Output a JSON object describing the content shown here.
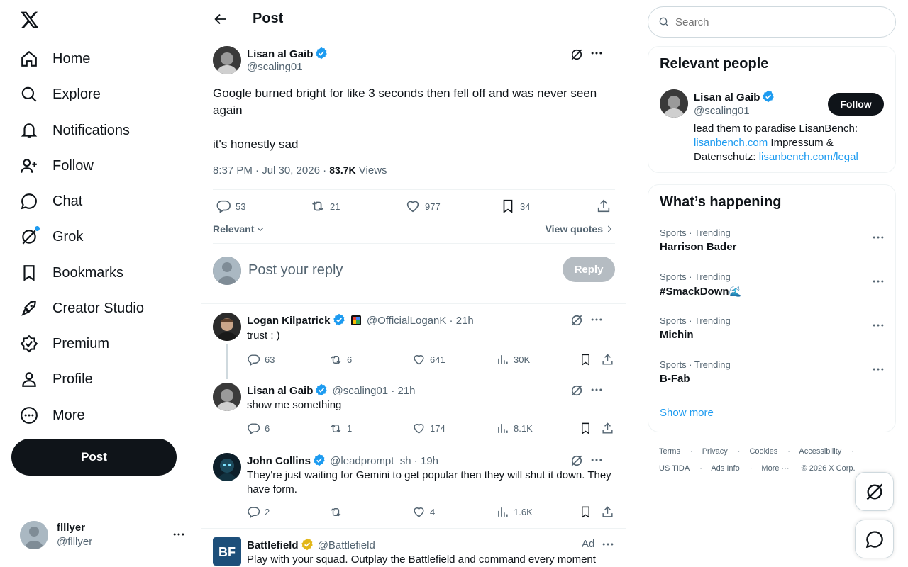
{
  "nav": {
    "items": [
      {
        "label": "Home",
        "icon": "home-icon"
      },
      {
        "label": "Explore",
        "icon": "search-icon"
      },
      {
        "label": "Notifications",
        "icon": "bell-icon"
      },
      {
        "label": "Follow",
        "icon": "person-add-icon"
      },
      {
        "label": "Chat",
        "icon": "chat-icon"
      },
      {
        "label": "Grok",
        "icon": "grok-icon"
      },
      {
        "label": "Bookmarks",
        "icon": "bookmark-icon"
      },
      {
        "label": "Creator Studio",
        "icon": "rocket-icon"
      },
      {
        "label": "Premium",
        "icon": "premium-icon"
      },
      {
        "label": "Profile",
        "icon": "person-icon"
      },
      {
        "label": "More",
        "icon": "more-circle-icon"
      }
    ],
    "post_label": "Post",
    "account": {
      "name": "flllyer",
      "handle": "@flllyer"
    }
  },
  "header": {
    "title": "Post"
  },
  "focal_post": {
    "name": "Lisan al Gaib",
    "handle": "@scaling01",
    "text": "Google burned bright for like 3 seconds then fell off and was never seen again\n\nit's honestly sad",
    "time": "8:37 PM · Jul 30, 2026 · ",
    "views": "83.7K",
    "views_label": " Views",
    "replies": "53",
    "reposts": "21",
    "likes": "977",
    "bookmarks": "34",
    "sort_label": "Relevant",
    "view_quotes": "View quotes"
  },
  "reply_box": {
    "placeholder": "Post your reply",
    "button": "Reply"
  },
  "replies": [
    {
      "name": "Logan Kilpatrick",
      "handle": "@OfficialLoganK",
      "time": "21h",
      "text": "trust : )",
      "replies": "63",
      "reposts": "6",
      "likes": "641",
      "views": "30K"
    },
    {
      "name": "Lisan al Gaib",
      "handle": "@scaling01",
      "time": "21h",
      "text": "show me something",
      "replies": "6",
      "reposts": "1",
      "likes": "174",
      "views": "8.1K"
    },
    {
      "name": "John Collins",
      "handle": "@leadprompt_sh",
      "time": "19h",
      "text": "They're just waiting for Gemini to get popular then they will shut it down. They have form.",
      "replies": "2",
      "reposts": "",
      "likes": "4",
      "views": "1.6K"
    },
    {
      "name": "Battlefield",
      "handle": "@Battlefield",
      "time": "Ad",
      "text": "Play with your squad. Outplay the Battlefield and command every moment"
    }
  ],
  "search": {
    "placeholder": "Search"
  },
  "relevant_people": {
    "title": "Relevant people",
    "name": "Lisan al Gaib",
    "handle": "@scaling01",
    "follow": "Follow",
    "bio_prefix": "lead them to paradise LisanBench: ",
    "bio_link1": "lisanbench.com",
    "bio_mid": " Impressum & Datenschutz: ",
    "bio_link2": "lisanbench.com/legal"
  },
  "trends": {
    "title": "What’s happening",
    "items": [
      {
        "category": "Sports · Trending",
        "title": "Harrison Bader"
      },
      {
        "category": "Sports · Trending",
        "title": "#SmackDown🌊"
      },
      {
        "category": "Sports · Trending",
        "title": "Michin"
      },
      {
        "category": "Sports · Trending",
        "title": "B-Fab"
      }
    ],
    "show_more": "Show more"
  },
  "footer": {
    "line1": [
      "Terms",
      "Privacy",
      "Cookies",
      "Accessibility"
    ],
    "line2": [
      "US TIDA",
      "Ads Info",
      "More ···",
      "© 2026 X Corp."
    ]
  },
  "colors": {
    "accent": "#1d9bf0",
    "text": "#0f1419",
    "muted": "#536471",
    "verified_gold": "#e2b719"
  }
}
